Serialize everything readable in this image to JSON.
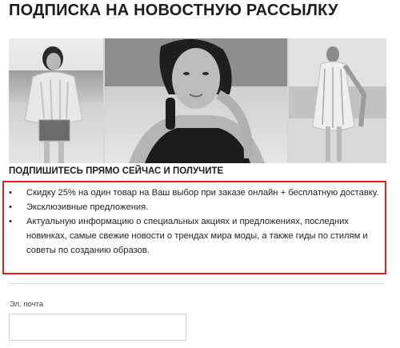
{
  "page": {
    "title": "ПОДПИСКА НА НОВОСТНУЮ РАССЫЛКУ"
  },
  "hero": {
    "images": [
      {
        "name": "model-knit-sweater-photo"
      },
      {
        "name": "model-portrait-earrings-photo"
      },
      {
        "name": "model-striped-dress-photo"
      }
    ]
  },
  "benefits": {
    "heading": "ПОДПИШИТЕСЬ ПРЯМО СЕЙЧАС И ПОЛУЧИТЕ",
    "bullet": "•",
    "items": [
      "Скидку 25% на один товар на Ваш выбор при заказе онлайн + бесплатную доставку.",
      "Эксклюзивные предложения.",
      "Актуальную информацию о специальных акциях и предложениях, последних новинках, самые свежие новости о трендах мира моды, а также гиды по стилям и советы по созданию образов."
    ]
  },
  "form": {
    "email_label": "Эл. почта",
    "email_value": "",
    "email_placeholder": ""
  },
  "colors": {
    "highlight_border": "#e02020",
    "divider": "#d8d8d8"
  }
}
